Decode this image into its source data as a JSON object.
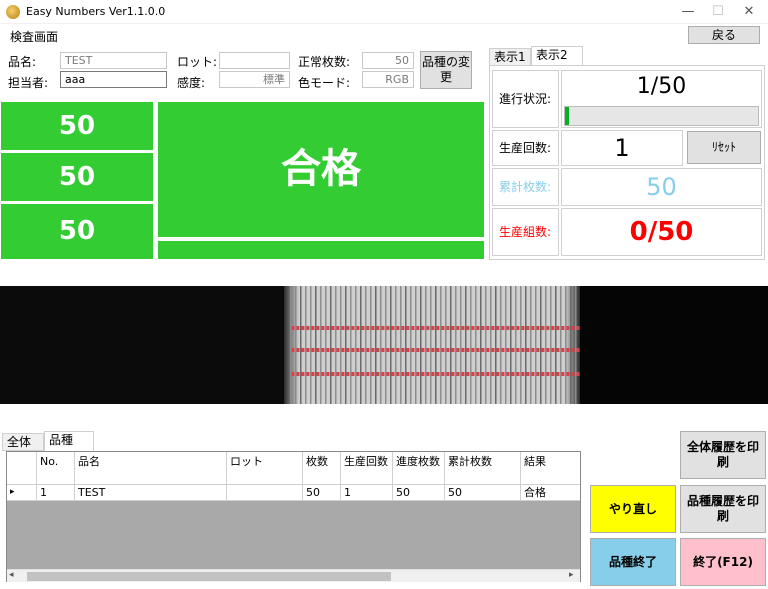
{
  "window": {
    "title": "Easy Numbers Ver1.1.0.0",
    "min": "—",
    "max": "☐",
    "close": "✕"
  },
  "header": {
    "screen_title": "検査画面",
    "back_label": "戻る"
  },
  "info": {
    "product_name_label": "品名:",
    "product_name_value": "TEST",
    "person_label": "担当者:",
    "person_value": "aaa",
    "lot_label": "ロット:",
    "lot_value": "",
    "sensitivity_label": "感度:",
    "sensitivity_value": "標準",
    "normal_count_label": "正常枚数:",
    "normal_count_value": "50",
    "color_mode_label": "色モード:",
    "color_mode_value": "RGB",
    "change_button": "品種の変更"
  },
  "counters": {
    "values": [
      "50",
      "50",
      "50"
    ],
    "verdict": "合格"
  },
  "right_panel": {
    "tabs": [
      "表示1",
      "表示2"
    ],
    "selected_tab": 1,
    "progress_label": "進行状況:",
    "progress_value": "1/50",
    "progress_fraction": 0.02,
    "production_count_label": "生産回数:",
    "production_count_value": "1",
    "reset_label": "ﾘｾｯﾄ",
    "cumulative_label": "累計枚数:",
    "cumulative_value": "50",
    "sets_label": "生産組数:",
    "sets_value": "0/50"
  },
  "colors": {
    "green": "#33cc33",
    "cumulative": "#87ceeb",
    "sets": "#ff0000",
    "yellow": "#ffff00",
    "blue": "#87ceeb",
    "pink": "#ffc0cb"
  },
  "bottom_tabs": [
    "全体",
    "品種"
  ],
  "grid": {
    "headers": [
      "No.",
      "品名",
      "ロット",
      "枚数",
      "生産回数",
      "進度枚数",
      "累計枚数",
      "結果"
    ],
    "rows": [
      {
        "marker": "▸",
        "cells": [
          "1",
          "TEST",
          "",
          "50",
          "1",
          "50",
          "50",
          "合格"
        ]
      }
    ]
  },
  "scroll": {
    "left": "◂",
    "right": "▸"
  },
  "buttons": {
    "print_all": "全体履歴を印刷",
    "redo": "やり直し",
    "print_product": "品種履歴を印刷",
    "product_end": "品種終了",
    "exit": "終了(F12)"
  }
}
